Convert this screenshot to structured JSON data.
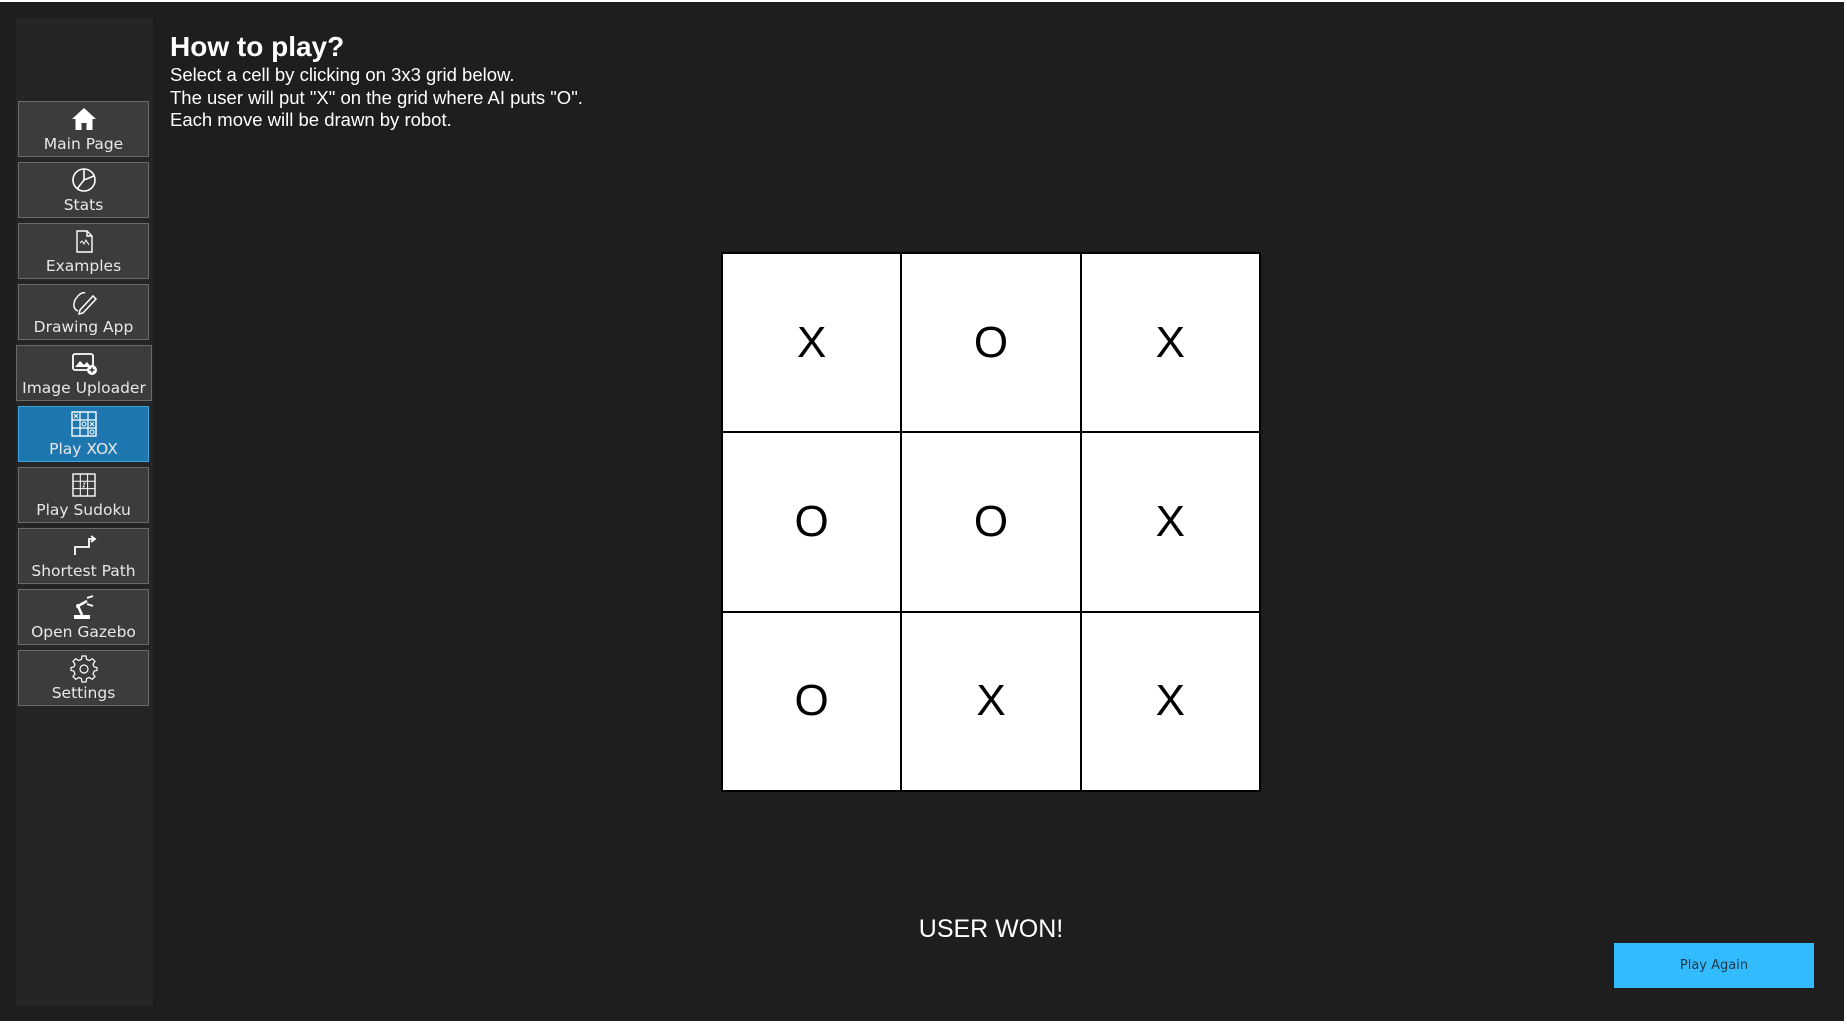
{
  "sidebar": {
    "items": [
      {
        "label": "Main Page",
        "icon": "home-icon",
        "active": false
      },
      {
        "label": "Stats",
        "icon": "pie-chart-icon",
        "active": false
      },
      {
        "label": "Examples",
        "icon": "document-icon",
        "active": false
      },
      {
        "label": "Drawing App",
        "icon": "pencil-icon",
        "active": false
      },
      {
        "label": "Image Uploader",
        "icon": "image-upload-icon",
        "active": false
      },
      {
        "label": "Play XOX",
        "icon": "xox-grid-icon",
        "active": true
      },
      {
        "label": "Play Sudoku",
        "icon": "sudoku-grid-icon",
        "active": false
      },
      {
        "label": "Shortest Path",
        "icon": "path-arrow-icon",
        "active": false
      },
      {
        "label": "Open Gazebo",
        "icon": "robot-arm-icon",
        "active": false
      },
      {
        "label": "Settings",
        "icon": "gear-icon",
        "active": false
      }
    ]
  },
  "instructions": {
    "title": "How to play?",
    "lines": [
      "Select a cell by clicking on 3x3 grid below.",
      "The user will put \"X\" on the grid where AI puts \"O\".",
      "Each move will be drawn by robot."
    ]
  },
  "board": {
    "cells": [
      "X",
      "O",
      "X",
      "O",
      "O",
      "X",
      "O",
      "X",
      "X"
    ]
  },
  "result": {
    "text": "USER WON!"
  },
  "actions": {
    "play_again_label": "Play Again"
  },
  "colors": {
    "background": "#1e1e1e",
    "sidebar": "#252525",
    "nav_button": "#3c3c3c",
    "nav_active": "#1f77b0",
    "play_again": "#33bbff"
  }
}
